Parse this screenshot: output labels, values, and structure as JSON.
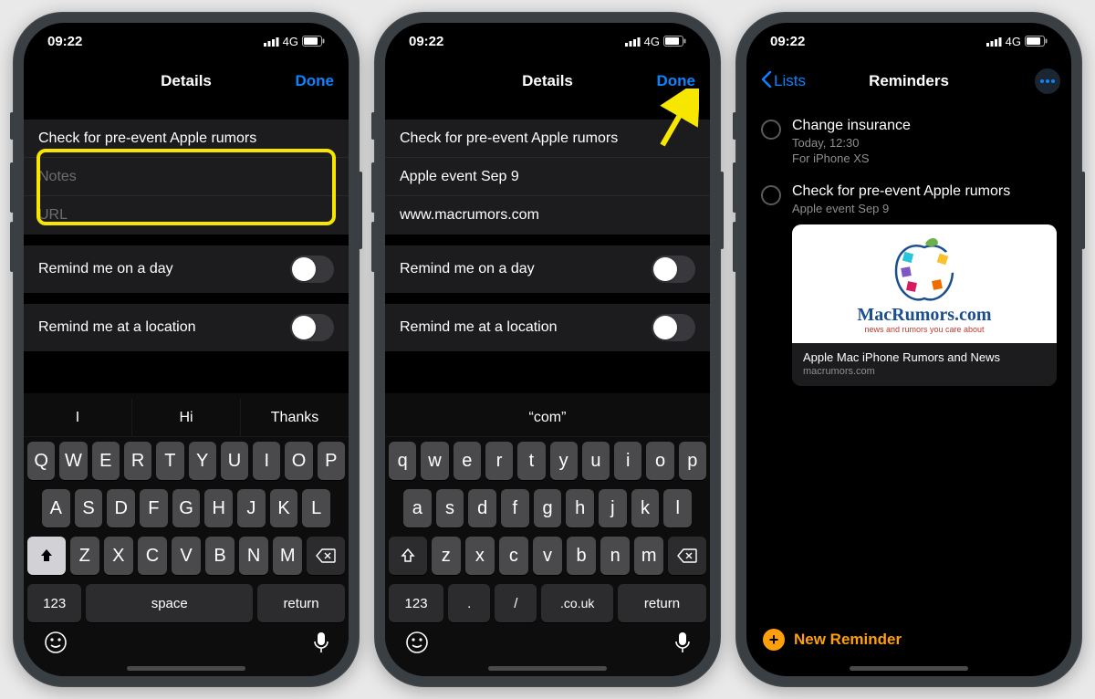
{
  "status": {
    "time": "09:22",
    "network": "4G"
  },
  "nav": {
    "details": "Details",
    "done": "Done",
    "lists": "Lists",
    "reminders": "Reminders"
  },
  "p1": {
    "title_value": "Check for pre-event Apple rumors",
    "notes_placeholder": "Notes",
    "url_placeholder": "URL",
    "remind_day": "Remind me on a day",
    "remind_loc": "Remind me at a location",
    "suggestions": [
      "I",
      "Hi",
      "Thanks"
    ]
  },
  "p2": {
    "title_value": "Check for pre-event Apple rumors",
    "notes_value": "Apple event Sep 9",
    "url_value": "www.macrumors.com",
    "remind_day": "Remind me on a day",
    "remind_loc": "Remind me at a location",
    "suggestions": [
      "“com”"
    ]
  },
  "p3": {
    "items": [
      {
        "title": "Change insurance",
        "sub1": "Today, 12:30",
        "sub2": "For iPhone XS"
      },
      {
        "title": "Check for pre-event Apple rumors",
        "sub1": "Apple event Sep 9"
      }
    ],
    "card": {
      "brand": "MacRumors.com",
      "tag": "news and rumors you care about",
      "title": "Apple Mac iPhone Rumors and News",
      "host": "macrumors.com"
    },
    "new_reminder": "New Reminder"
  },
  "kbd": {
    "r1_upper": [
      "Q",
      "W",
      "E",
      "R",
      "T",
      "Y",
      "U",
      "I",
      "O",
      "P"
    ],
    "r2_upper": [
      "A",
      "S",
      "D",
      "F",
      "G",
      "H",
      "J",
      "K",
      "L"
    ],
    "r3_upper": [
      "Z",
      "X",
      "C",
      "V",
      "B",
      "N",
      "M"
    ],
    "r1_lower": [
      "q",
      "w",
      "e",
      "r",
      "t",
      "y",
      "u",
      "i",
      "o",
      "p"
    ],
    "r2_lower": [
      "a",
      "s",
      "d",
      "f",
      "g",
      "h",
      "j",
      "k",
      "l"
    ],
    "r3_lower": [
      "z",
      "x",
      "c",
      "v",
      "b",
      "n",
      "m"
    ],
    "num": "123",
    "space": "space",
    "ret": "return",
    "alt_row": [
      ".",
      "/",
      ".co.uk"
    ]
  }
}
